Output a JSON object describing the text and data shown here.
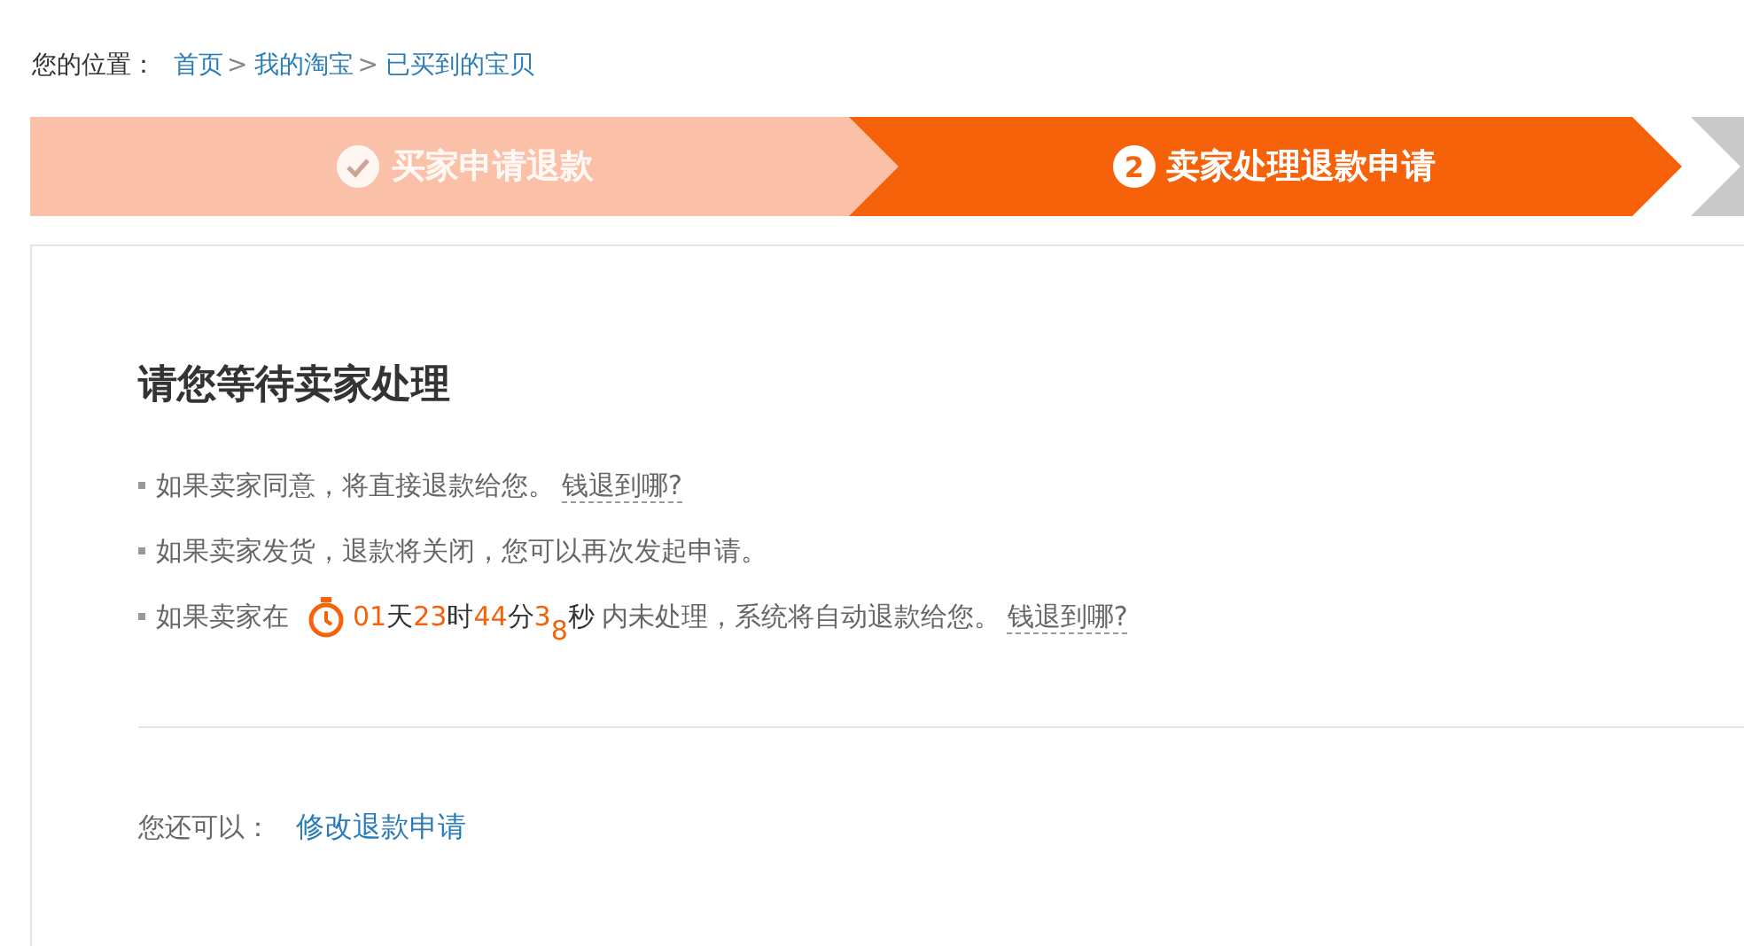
{
  "breadcrumb": {
    "label": "您的位置：",
    "links": [
      {
        "text": "首页"
      },
      {
        "text": "我的淘宝"
      },
      {
        "text": "已买到的宝贝"
      }
    ],
    "separator": ">"
  },
  "steps": [
    {
      "label": "买家申请退款",
      "completed": true,
      "selected": false
    },
    {
      "label": "卖家处理退款申请",
      "completed": false,
      "selected": true,
      "number": "2"
    }
  ],
  "panel": {
    "heading": "请您等待卖家处理",
    "notes": [
      {
        "kind": "plain",
        "text": "如果卖家同意，将直接退款给您。",
        "link": "钱退到哪?"
      },
      {
        "kind": "plain",
        "text": "如果卖家发货，退款将关闭，您可以再次发起申请。"
      },
      {
        "kind": "timer",
        "before": "如果卖家在",
        "countdown": [
          {
            "value": "01",
            "unit": "天"
          },
          {
            "value": "23",
            "unit": "时"
          },
          {
            "value": "44",
            "unit": "分"
          },
          {
            "value": "3$_{8}$",
            "unit": "秒"
          }
        ],
        "after": "内未处理，系统将自动退款给您。",
        "link": "钱退到哪?"
      }
    ],
    "actions_label": "您还可以：",
    "action_link": "修改退款申请"
  }
}
